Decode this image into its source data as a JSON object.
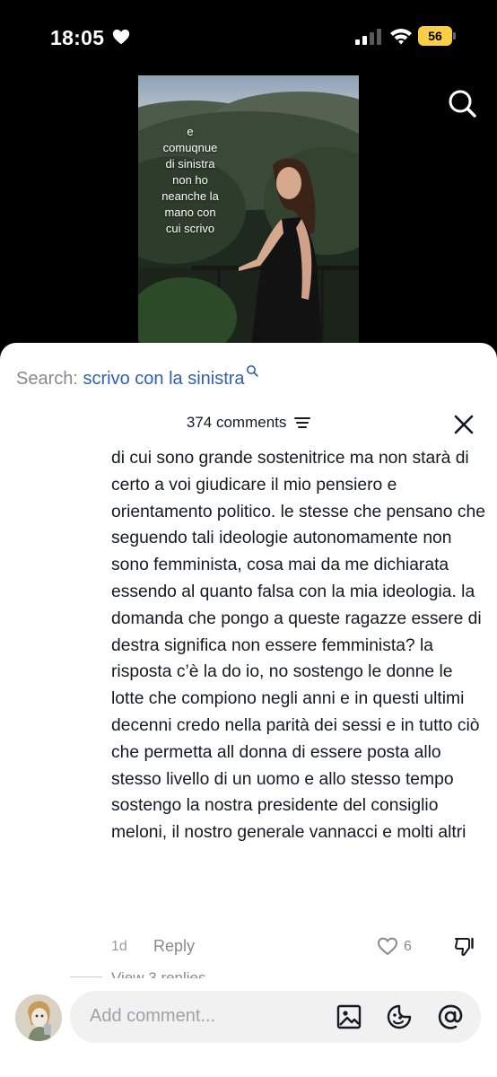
{
  "status_bar": {
    "time": "18:05",
    "battery": "56"
  },
  "video": {
    "overlay_text": "e\ncomuqnue\ndi sinistra\nnon ho\nneanche la\nmano con\ncui scrivo"
  },
  "search": {
    "label": "Search:",
    "query": "scrivo con la sinistra"
  },
  "comments": {
    "count_label": "374 comments",
    "comment": {
      "text": "di cui sono grande sostenitrice ma non starà di certo a voi giudicare il mio pensiero e orientamento politico. le stesse che pensano che seguendo tali ideologie autonomamente non sono femminista, cosa mai da me dichiarata essendo al quanto falsa con la mia ideologia. la domanda che pongo a queste ragazze essere di destra significa non essere femminista? la risposta c’è la do io, no sostengo le donne le lotte che compiono negli anni e in questi ultimi decenni credo nella parità dei sessi e in tutto ciò che permetta all donna di essere posta allo stesso livello di un uomo e allo stesso tempo sostengo la nostra presidente del consiglio meloni, il nostro generale vannacci e molti altri",
      "time": "1d",
      "reply_label": "Reply",
      "likes": "6",
      "view_replies_label": "View 3 replies"
    }
  },
  "input": {
    "placeholder": "Add comment..."
  },
  "colors": {
    "link_blue": "#2f5fb4",
    "battery_yellow": "#f7ce46",
    "muted_gray": "#8a8a8a"
  }
}
